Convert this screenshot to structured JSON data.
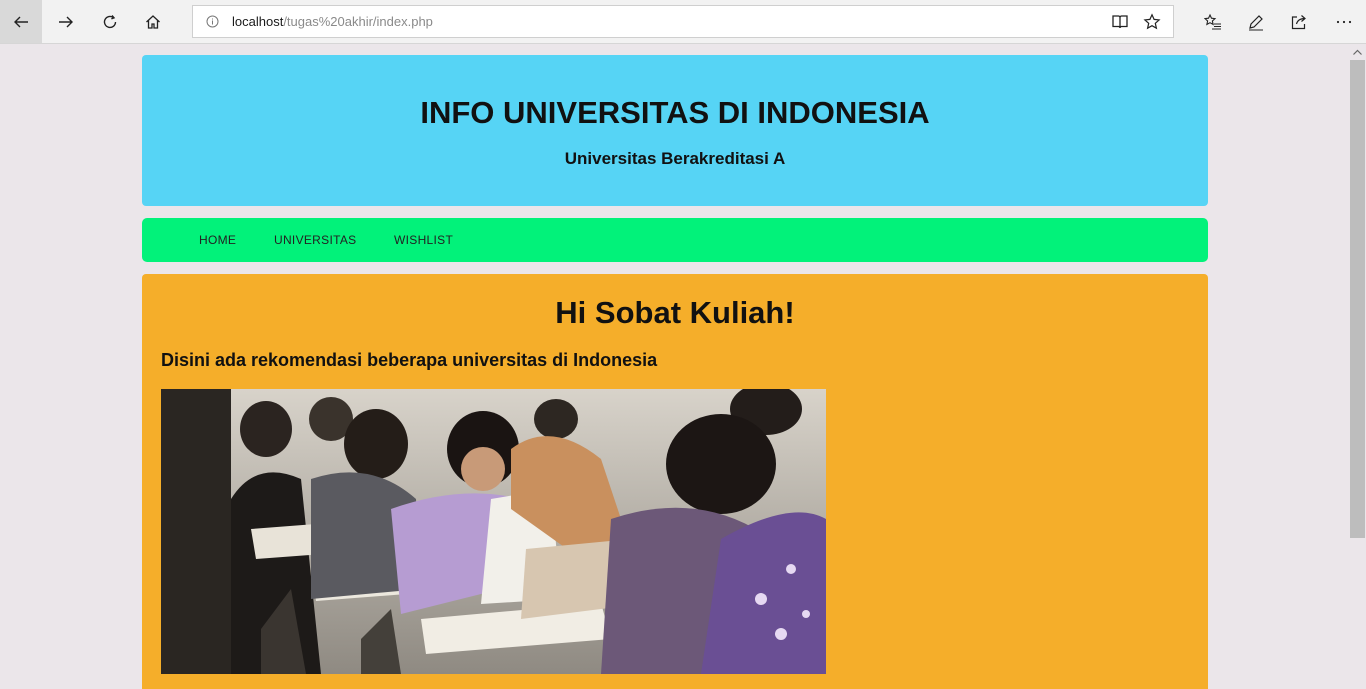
{
  "browser": {
    "url_host": "localhost",
    "url_path": "/tugas%20akhir/index.php"
  },
  "header": {
    "title": "INFO UNIVERSITAS DI INDONESIA",
    "subtitle": "Universitas Berakreditasi A"
  },
  "nav": {
    "items": [
      {
        "label": "HOME"
      },
      {
        "label": "UNIVERSITAS"
      },
      {
        "label": "WISHLIST"
      }
    ]
  },
  "main": {
    "heading": "Hi Sobat Kuliah!",
    "subheading": "Disini ada rekomendasi beberapa universitas di Indonesia"
  },
  "colors": {
    "header_bg": "#56d4f5",
    "nav_bg": "#02f27a",
    "main_bg": "#f5ae2a",
    "page_bg": "#ebe6ea"
  },
  "icons": [
    "back-icon",
    "forward-icon",
    "refresh-icon",
    "home-icon",
    "info-icon",
    "reading-view-icon",
    "favorite-star-icon",
    "favorites-list-icon",
    "pen-icon",
    "share-icon",
    "more-icon"
  ]
}
